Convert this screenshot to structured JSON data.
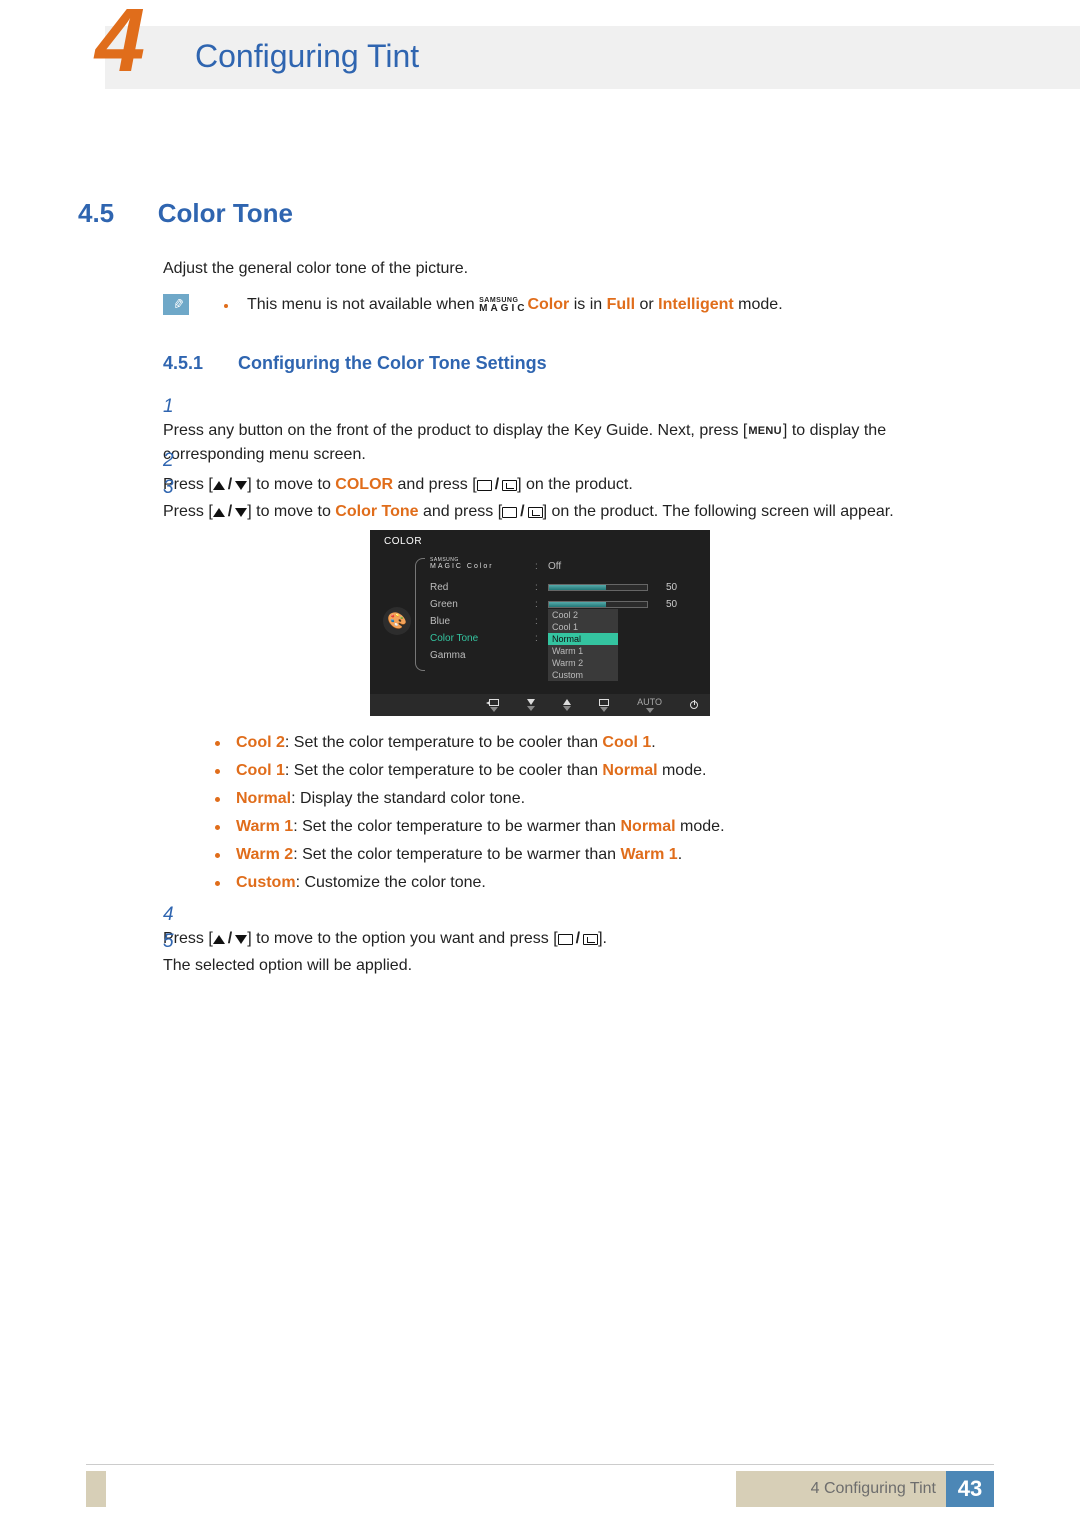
{
  "chapter": {
    "number": "4",
    "title": "Configuring Tint"
  },
  "section": {
    "number": "4.5",
    "title": "Color Tone"
  },
  "intro": "Adjust the general color tone of the picture.",
  "note": {
    "pre": "This menu is not available when ",
    "magic_sup": "SAMSUNG",
    "magic_sub": "MAGIC",
    "color_word": "Color",
    "mid": " is in ",
    "full": "Full",
    "or": " or ",
    "intelligent": "Intelligent",
    "post": " mode."
  },
  "subsection": {
    "number": "4.5.1",
    "title": "Configuring the Color Tone Settings"
  },
  "steps": {
    "s1": {
      "n": "1",
      "a": "Press any button on the front of the product to display the Key Guide. Next, press [",
      "menu": "MENU",
      "b": "] to display the corresponding menu screen."
    },
    "s2": {
      "n": "2",
      "a": "Press [",
      "b": "] to move to ",
      "color": "COLOR",
      "c": " and press [",
      "d": "] on the product."
    },
    "s3": {
      "n": "3",
      "a": "Press [",
      "b": "] to move to ",
      "ct": "Color Tone",
      "c": " and press [",
      "d": "] on the product. The following screen will appear."
    },
    "s4": {
      "n": "4",
      "a": "Press [",
      "b": "] to move to the option you want and press [",
      "c": "]."
    },
    "s5": {
      "n": "5",
      "a": "The selected option will be applied."
    }
  },
  "osd": {
    "title": "COLOR",
    "magic_sup": "SAMSUNG",
    "magic_sub": "MAGIC",
    "magic_color": "Color",
    "items": {
      "red": "Red",
      "green": "Green",
      "blue": "Blue",
      "ct": "Color Tone",
      "gamma": "Gamma"
    },
    "off": "Off",
    "val50": "50",
    "options": {
      "cool2": "Cool 2",
      "cool1": "Cool 1",
      "normal": "Normal",
      "warm1": "Warm 1",
      "warm2": "Warm 2",
      "custom": "Custom"
    },
    "auto": "AUTO"
  },
  "explain": {
    "cool2": {
      "t": "Cool 2",
      "mid": ": Set the color temperature to be cooler than ",
      "ref": "Cool 1",
      "end": "."
    },
    "cool1": {
      "t": "Cool 1",
      "mid": ": Set the color temperature to be cooler than ",
      "ref": "Normal",
      "end": " mode."
    },
    "normal": {
      "t": "Normal",
      "mid": ": Display the standard color tone."
    },
    "warm1": {
      "t": "Warm 1",
      "mid": ": Set the color temperature to be warmer than ",
      "ref": "Normal",
      "end": " mode."
    },
    "warm2": {
      "t": "Warm 2",
      "mid": ": Set the color temperature to be warmer than ",
      "ref": "Warm 1",
      "end": "."
    },
    "custom": {
      "t": "Custom",
      "mid": ": Customize the color tone."
    }
  },
  "footer": {
    "chapter_label": "4 Configuring Tint",
    "page": "43"
  }
}
